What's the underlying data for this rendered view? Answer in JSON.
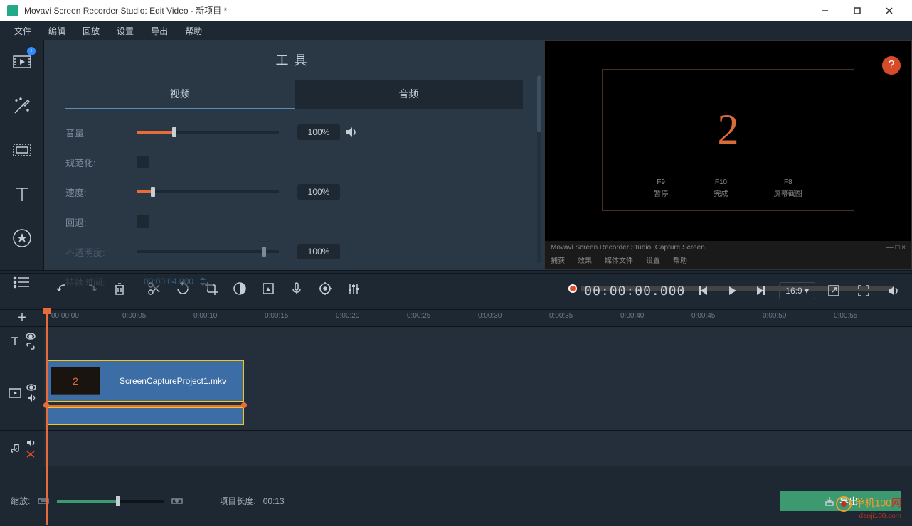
{
  "titlebar": {
    "title": "Movavi Screen Recorder Studio: Edit Video - 新项目 *"
  },
  "menubar": [
    "文件",
    "编辑",
    "回放",
    "设置",
    "导出",
    "帮助"
  ],
  "tools": {
    "title": "工具",
    "tabs": {
      "video": "视频",
      "audio": "音频"
    },
    "volume": {
      "label": "音量:",
      "value": "100%"
    },
    "normalize": {
      "label": "规范化:"
    },
    "speed": {
      "label": "速度:",
      "value": "100%"
    },
    "reverse": {
      "label": "回退:"
    },
    "opacity": {
      "label": "不透明度:",
      "value": "100%"
    },
    "duration": {
      "label": "持续时间:",
      "value": "00:00:04.000"
    }
  },
  "preview": {
    "countdown": "2",
    "controls": [
      {
        "key": "F9",
        "label": "暂停"
      },
      {
        "key": "F10",
        "label": "完成"
      },
      {
        "key": "F8",
        "label": "屏幕截图"
      }
    ],
    "capture_title": "Movavi Screen Recorder Studio: Capture Screen",
    "capture_menu": [
      "捕获",
      "效果",
      "媒体文件",
      "设置",
      "帮助"
    ]
  },
  "playback": {
    "timecode": "00:00:00.000",
    "aspect": "16:9"
  },
  "ruler": [
    "00:00:00",
    "0:00:05",
    "0:00:10",
    "0:00:15",
    "0:00:20",
    "0:00:25",
    "0:00:30",
    "0:00:35",
    "0:00:40",
    "0:00:45",
    "0:00:50",
    "0:00:55"
  ],
  "clip": {
    "name": "ScreenCaptureProject1.mkv"
  },
  "bottom": {
    "zoom_label": "缩放:",
    "project_len_label": "项目长度:",
    "project_len": "00:13",
    "export": "导出"
  },
  "watermark": {
    "part1": "单机100",
    "part2": "网",
    "part3": "danji100.com"
  }
}
